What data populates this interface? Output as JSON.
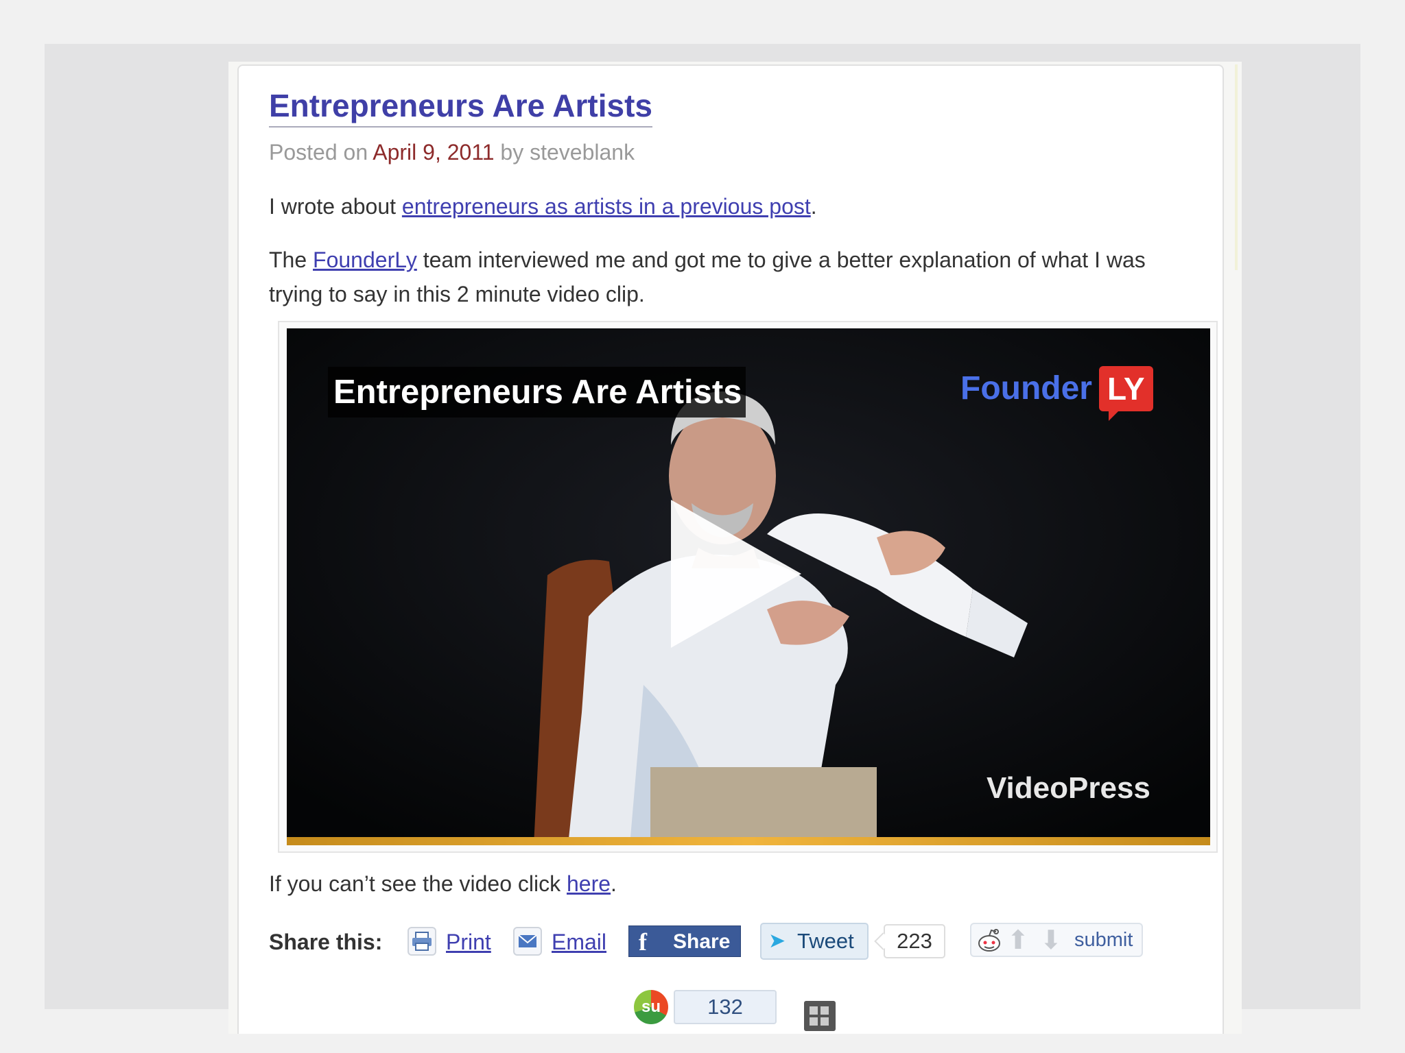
{
  "post": {
    "title": "Entrepreneurs Are Artists",
    "meta_prefix": "Posted on ",
    "date": "April 9, 2011",
    "meta_by": " by ",
    "author": "steveblank"
  },
  "body": {
    "p1_before": "I wrote about ",
    "p1_link": "entrepreneurs as artists in a previous post",
    "p1_after": ".",
    "p2_before": "The ",
    "p2_link": "FounderLy",
    "p2_after": " team interviewed me and got me to give a better explanation of what I was trying to say in this 2 minute video clip.",
    "p3_before": "If you can’t see the video click ",
    "p3_link": "here",
    "p3_after": "."
  },
  "video": {
    "overlay_title": "Entrepreneurs Are Artists",
    "logo_founder": "Founder",
    "logo_ly": "LY",
    "watermark": "VideoPress",
    "progress_bar_color": "#f0b43c",
    "play_icon": "play-icon"
  },
  "share": {
    "label": "Share this:",
    "print": "Print",
    "email": "Email",
    "facebook": "Share",
    "tweet": "Tweet",
    "tweet_count": "223",
    "reddit_submit": "submit",
    "stumble_icon": "su",
    "stumble_count": "132",
    "facebook_color": "#3b5a98"
  }
}
